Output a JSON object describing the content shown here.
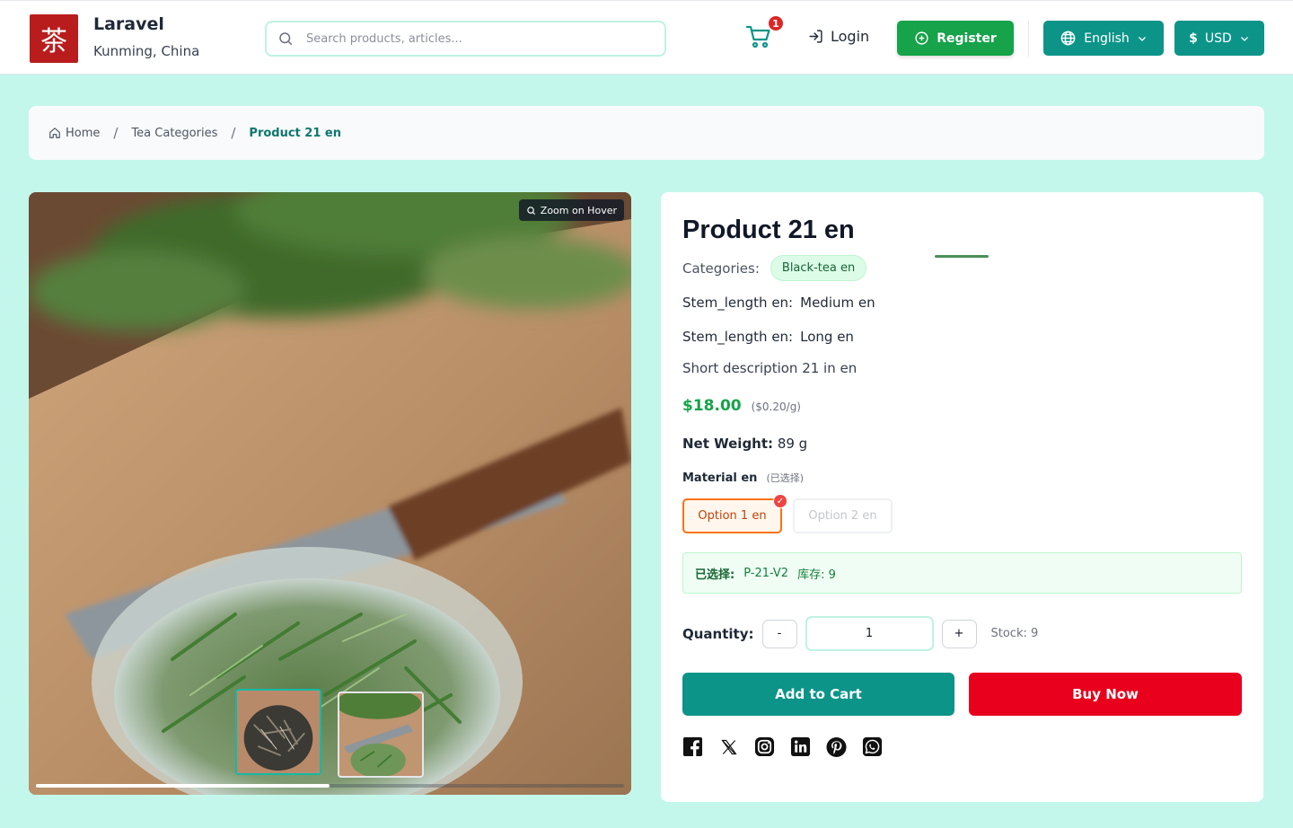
{
  "header": {
    "logo_char": "茶",
    "brand_name": "Laravel",
    "brand_location": "Kunming, China",
    "search_placeholder": "Search products, articles...",
    "cart_count": "1",
    "login_label": "Login",
    "register_label": "Register",
    "language_label": "English",
    "currency_symbol": "$",
    "currency_label": "USD"
  },
  "breadcrumb": {
    "home": "Home",
    "category": "Tea Categories",
    "current": "Product 21 en",
    "separator": "/"
  },
  "gallery": {
    "zoom_label": "Zoom on Hover",
    "thumbnail_count": 2,
    "selected_thumbnail": 1
  },
  "product": {
    "title": "Product 21 en",
    "categories_label": "Categories:",
    "category": "Black-tea en",
    "attributes": [
      {
        "key": "Stem_length en:",
        "value": "Medium en"
      },
      {
        "key": "Stem_length en:",
        "value": "Long en"
      }
    ],
    "short_description": "Short description 21 in en",
    "price": "$18.00",
    "unit_price": "($0.20/g)",
    "net_weight_label": "Net Weight:",
    "net_weight_value": "89 g",
    "material_label": "Material en",
    "material_hint": "(已选择)",
    "options": [
      {
        "label": "Option 1 en",
        "selected": true
      },
      {
        "label": "Option 2 en",
        "selected": false
      }
    ],
    "selected_label": "已选择:",
    "selected_sku": "P-21-V2",
    "stock_label_cn": "库存: 9",
    "quantity_label": "Quantity:",
    "qty_minus": "-",
    "qty_value": "1",
    "qty_plus": "+",
    "stock_text": "Stock: 9",
    "add_to_cart": "Add to Cart",
    "buy_now": "Buy Now"
  },
  "social": [
    "facebook-icon",
    "x-icon",
    "instagram-icon",
    "linkedin-icon",
    "pinterest-icon",
    "whatsapp-icon"
  ],
  "colors": {
    "page_bg": "#c4f7ec",
    "teal": "#0d9488",
    "green": "#16a34a",
    "red": "#e8001c",
    "orange": "#f97316"
  }
}
